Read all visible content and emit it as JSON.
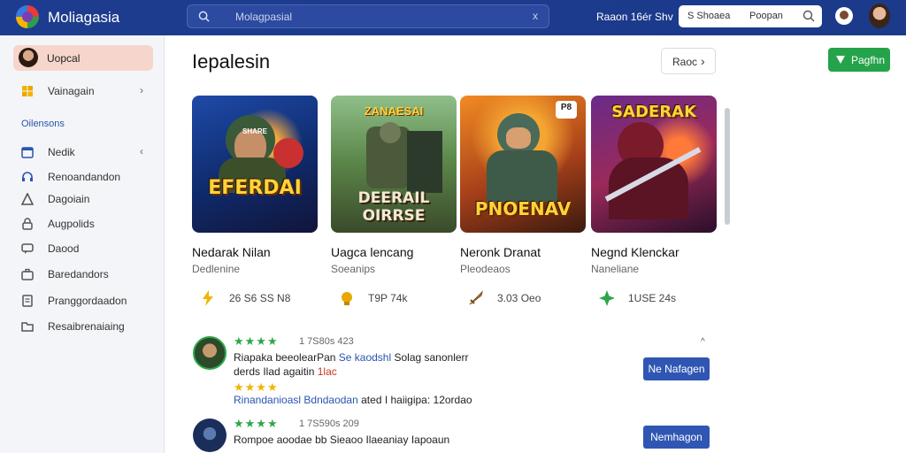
{
  "header": {
    "brand": "Moliagasia",
    "search_text": "Molagpasial",
    "search_clear": "x",
    "links": "Raaon 16ér Shv",
    "top_search_a": "S Shoaea",
    "top_search_b": "Poopan"
  },
  "sidebar": {
    "profile_label": "Uopcal",
    "top_item": "Vainagain",
    "section_title": "Oilensons",
    "items": [
      {
        "label": "Nedik",
        "icon": "calendar-icon"
      },
      {
        "label": "Renoandandon",
        "icon": "headset-icon"
      },
      {
        "label": "Dagoiain",
        "icon": "triangle-icon"
      },
      {
        "label": "Augpolids",
        "icon": "lock-icon"
      },
      {
        "label": "Daood",
        "icon": "chat-icon"
      },
      {
        "label": "Baredandors",
        "icon": "briefcase-icon"
      },
      {
        "label": "Pranggordaadon",
        "icon": "document-icon"
      },
      {
        "label": "Resaibrenaiaing",
        "icon": "folder-icon"
      }
    ]
  },
  "main": {
    "title": "Iepalesin",
    "next_label": "Raoc",
    "green_label": "Pagfhn",
    "cards": [
      {
        "art_title": "EFERDAI",
        "art_top": "SHARE",
        "name": "Nedarak Nilan",
        "sub": "Dedlenine",
        "stat": "26 S6 SS N8",
        "icon": "lightning-icon",
        "accent": "#f0b400"
      },
      {
        "art_title": "DEERAIL OIRRSE",
        "art_top": "ZANAESAI",
        "name": "Uagca lencang",
        "sub": "Soeanips",
        "stat": "T9P 74k",
        "icon": "trophy-icon",
        "accent": "#e8a800"
      },
      {
        "art_title": "PNOENAV",
        "art_top": "P8",
        "name": "Neronk Dranat",
        "sub": "Pleodeaos",
        "stat": "3.03 Oeo",
        "icon": "sword-icon",
        "accent": "#c87a30"
      },
      {
        "art_title": "SADERAK",
        "art_top": "",
        "name": "Negnd Klenckar",
        "sub": "Naneliane",
        "stat": "1USE 24s",
        "icon": "star-icon",
        "accent": "#2ea64a"
      }
    ]
  },
  "reviews": [
    {
      "rating_meta": "1 7S80s 423",
      "line1_a": "Riapaka beeolearPan ",
      "line1_b": "Se kaodshl",
      "line1_c": " Solag sanonlerr",
      "line2_a": "derds Ilad agaitin ",
      "line2_b": "1lac",
      "line3_a": "Rinandanioasl Bdndaodan",
      "line3_b": " ated I haiigipa: 12ordao",
      "button": "Ne Nafagen"
    },
    {
      "rating_meta": "1 7S590s 209",
      "line1": "Rompoe aoodae bb Sieaoo Ilaeaniay Iapoaun",
      "button": "Nemhagon"
    }
  ]
}
